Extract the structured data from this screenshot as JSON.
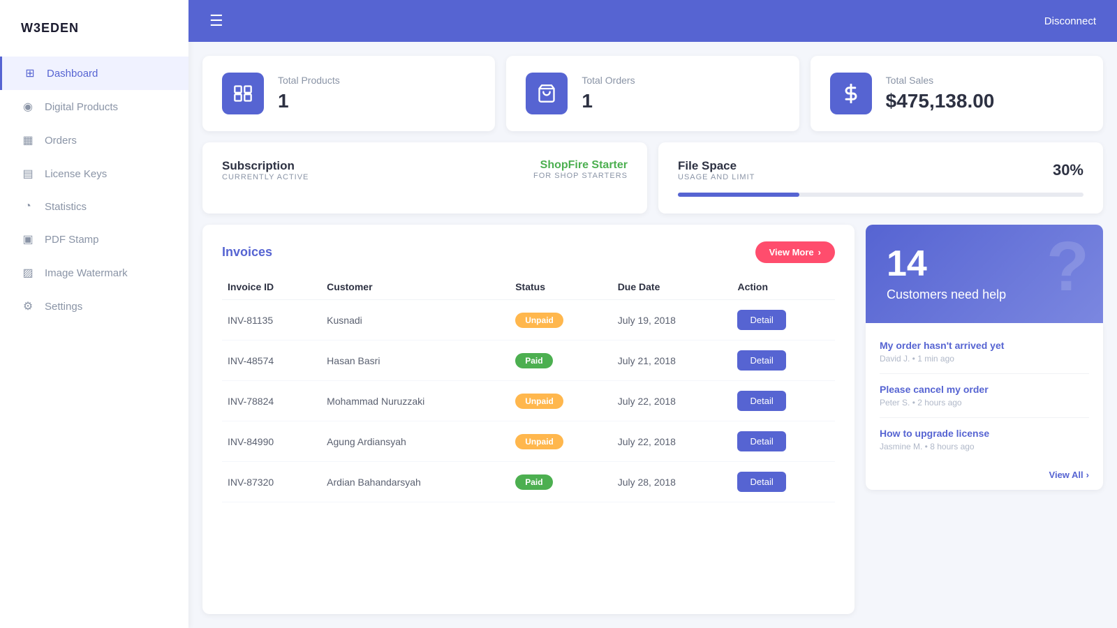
{
  "brand": "W3EDEN",
  "header": {
    "disconnect_label": "Disconnect"
  },
  "sidebar": {
    "items": [
      {
        "id": "dashboard",
        "label": "Dashboard",
        "icon": "⊞",
        "active": true
      },
      {
        "id": "digital-products",
        "label": "Digital Products",
        "icon": "◉"
      },
      {
        "id": "orders",
        "label": "Orders",
        "icon": "▦"
      },
      {
        "id": "license-keys",
        "label": "License Keys",
        "icon": "▤"
      },
      {
        "id": "statistics",
        "label": "Statistics",
        "icon": "◔"
      },
      {
        "id": "pdf-stamp",
        "label": "PDF Stamp",
        "icon": "▣"
      },
      {
        "id": "image-watermark",
        "label": "Image Watermark",
        "icon": "▨"
      },
      {
        "id": "settings",
        "label": "Settings",
        "icon": "⚙"
      }
    ]
  },
  "stats": {
    "products": {
      "label": "Total Products",
      "value": "1",
      "icon": "⊞"
    },
    "orders": {
      "label": "Total Orders",
      "value": "1",
      "icon": "🛍"
    },
    "sales": {
      "label": "Total Sales",
      "value": "$475,138.00",
      "icon": "$"
    }
  },
  "subscription": {
    "title": "Subscription",
    "subtitle": "Currently Active",
    "plan_name": "ShopFire Starter",
    "plan_desc": "For Shop Starters"
  },
  "filespace": {
    "title": "File Space",
    "subtitle": "Usage and Limit",
    "percent": "30%",
    "percent_num": 30
  },
  "invoices": {
    "title": "Invoices",
    "view_more_label": "View More",
    "columns": [
      "Invoice ID",
      "Customer",
      "Status",
      "Due Date",
      "Action"
    ],
    "rows": [
      {
        "id": "INV-81135",
        "customer": "Kusnadi",
        "status": "Unpaid",
        "due_date": "July 19, 2018"
      },
      {
        "id": "INV-48574",
        "customer": "Hasan Basri",
        "status": "Paid",
        "due_date": "July 21, 2018"
      },
      {
        "id": "INV-78824",
        "customer": "Mohammad Nuruzzaki",
        "status": "Unpaid",
        "due_date": "July 22, 2018"
      },
      {
        "id": "INV-84990",
        "customer": "Agung Ardiansyah",
        "status": "Unpaid",
        "due_date": "July 22, 2018"
      },
      {
        "id": "INV-87320",
        "customer": "Ardian Bahandarsyah",
        "status": "Paid",
        "due_date": "July 28, 2018"
      }
    ],
    "detail_label": "Detail"
  },
  "help": {
    "count": "14",
    "label": "Customers need help",
    "question_icon": "?",
    "tickets": [
      {
        "title": "My order hasn't arrived yet",
        "meta": "David J. • 1 min ago"
      },
      {
        "title": "Please cancel my order",
        "meta": "Peter S. • 2 hours ago"
      },
      {
        "title": "How to upgrade license",
        "meta": "Jasmine M. • 8 hours ago"
      }
    ],
    "view_all_label": "View All"
  }
}
